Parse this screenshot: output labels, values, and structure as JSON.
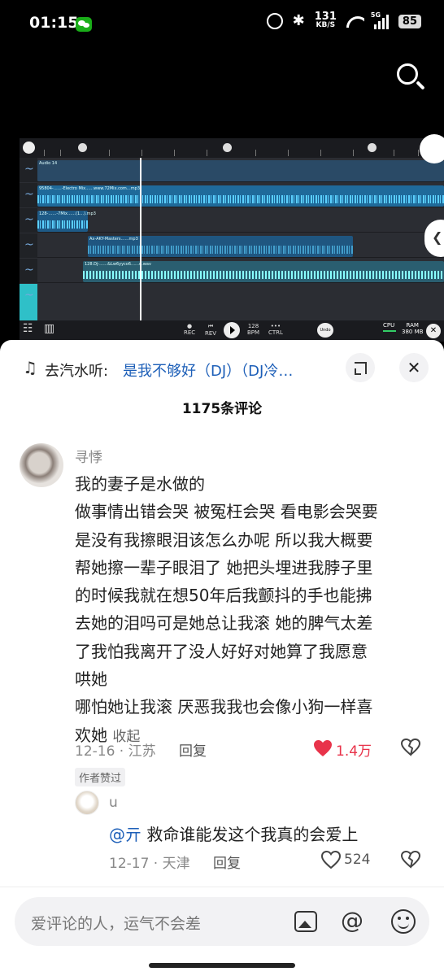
{
  "status_bar": {
    "time": "01:15",
    "net_speed_value": "131",
    "net_speed_unit": "KB/S",
    "network_type": "5G",
    "battery": "85",
    "icons": [
      "wechat-icon",
      "alarm-icon",
      "bluetooth-icon",
      "wifi-icon",
      "signal-icon",
      "battery-icon"
    ]
  },
  "top_actions": {
    "search_icon": "search-icon"
  },
  "video": {
    "daw": {
      "tracks": [
        {
          "name": "Audio 14",
          "color": "#2a4a66"
        },
        {
          "name": "95804-……-Electro Mix……www.72Mix.com…mp3",
          "color": "#1f6a9a"
        },
        {
          "name": "128-……-7Mix……(1…).mp3",
          "color": "#1e5a86"
        },
        {
          "name": "Ax-AKY-Masters……mp3",
          "color": "#1f5680"
        },
        {
          "name": "128.Dj-……&Lw6yyco6……d.wav",
          "color": "#2a5e70"
        }
      ],
      "tempo": "128",
      "tempo_unit": "BPM",
      "rec_label": "REC",
      "rev_label": "REV",
      "ctrl_label": "CTRL",
      "undo_label": "Undo",
      "cpu_label": "CPU",
      "ram_label": "RAM",
      "ram_value": "380 MB"
    }
  },
  "sheet": {
    "song_prefix": "去汽水听:",
    "song_title": "是我不够好（DJ）（DJ冷…",
    "comment_count": "1175条评论",
    "comment": {
      "user": "寻悸",
      "lines": [
        "我的妻子是水做的",
        "做事情出错会哭 被冤枉会哭 看电影会哭要",
        "是没有我擦眼泪该怎么办呢 所以我大概要",
        "帮她擦一辈子眼泪了 她把头埋进我脖子里",
        "的时候我就在想50年后我颤抖的手也能拂",
        "去她的泪吗可是她总让我滚 她的脾气太差",
        "了我怕我离开了没人好好对她算了我愿意",
        "哄她",
        "哪怕她让我滚 厌恶我我也会像小狗一样喜",
        "欢她"
      ],
      "collapse_label": "收起",
      "date_location": "12-16 · 江苏",
      "reply_label": "回复",
      "likes": "1.4万",
      "author_badge": "作者赞过"
    },
    "reply": {
      "user": "u",
      "mention": "@亓",
      "text": " 救命谁能发这个我真的会爱上",
      "date_location": "12-17 · 天津",
      "reply_label": "回复",
      "likes": "524"
    },
    "input": {
      "placeholder": "爱评论的人，运气不会差",
      "icons": [
        "image-icon",
        "at-icon",
        "emoji-icon"
      ]
    }
  },
  "colors": {
    "like_red": "#e8334a",
    "link_blue": "#1d5fb8",
    "daw_accent": "#2fc0c8"
  }
}
